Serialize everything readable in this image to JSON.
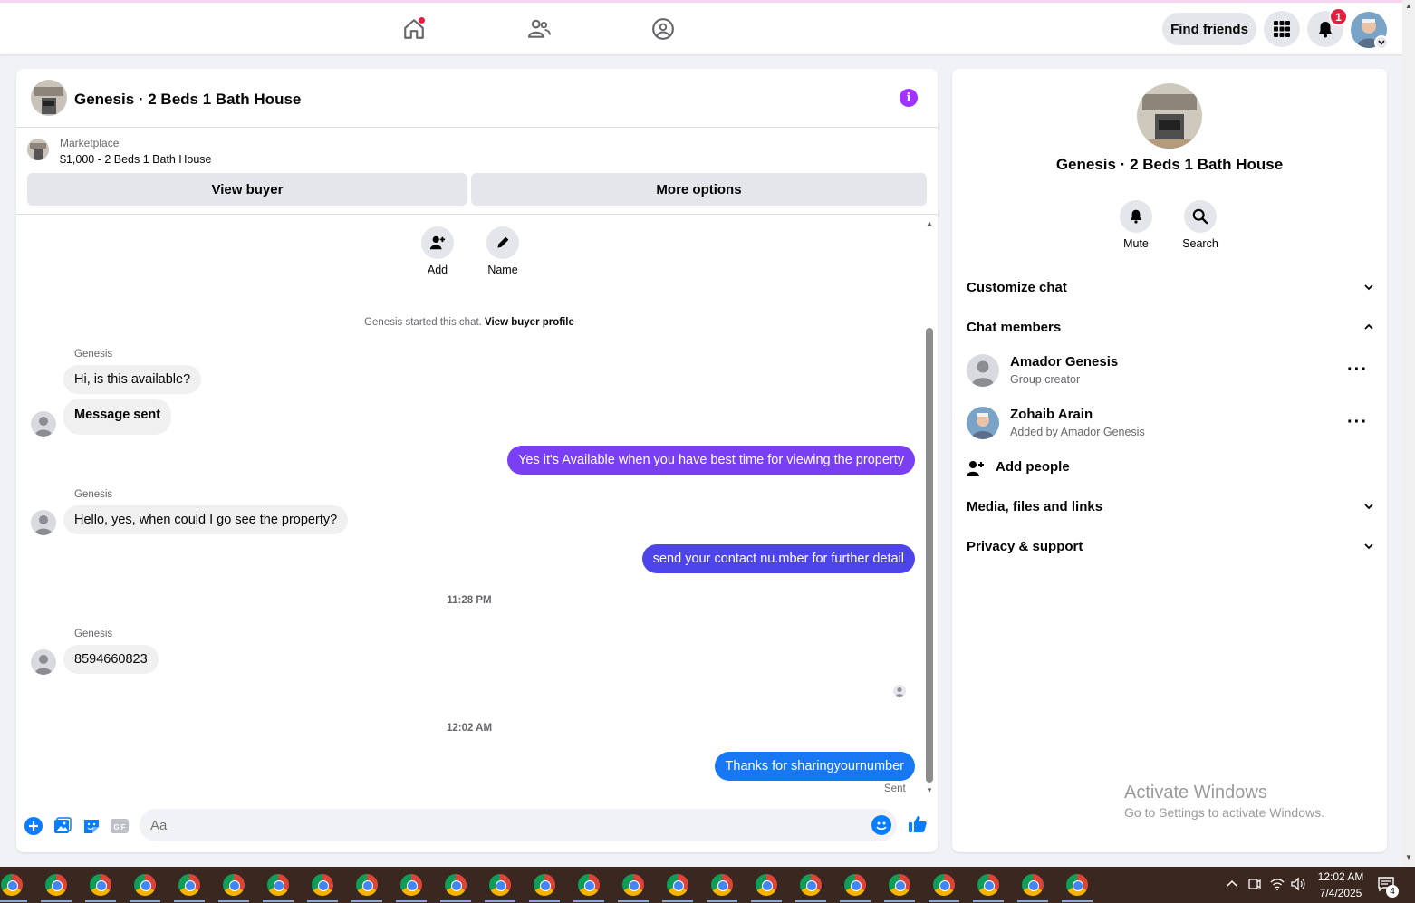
{
  "topnav": {
    "icons": [
      "home-icon",
      "friends-icon",
      "groups-icon"
    ],
    "find_friends_label": "Find friends",
    "notification_count": "1"
  },
  "chat": {
    "title": "Genesis · 2 Beds 1 Bath House",
    "marketplace_label": "Marketplace",
    "listing": "$1,000 - 2 Beds 1 Bath House",
    "view_buyer_label": "View buyer",
    "more_options_label": "More options",
    "actions": [
      {
        "label": "Add",
        "icon": "add-person-icon"
      },
      {
        "label": "Name",
        "icon": "pencil-icon"
      }
    ],
    "started_text": "Genesis started this chat. ",
    "view_profile_label": "View buyer profile",
    "messages": {
      "sender_1": "Genesis",
      "m1": "Hi, is this available?",
      "m2": "Message sent",
      "m3": "Yes it's Available when you have best time for viewing the property",
      "sender_2": "Genesis",
      "m4": "Hello, yes, when could I go see the property?",
      "m5": "send your contact nu.mber for further detail",
      "time_1": "11:28 PM",
      "sender_3": "Genesis",
      "m6": "8594660823",
      "time_2": "12:02 AM",
      "m7": "Thanks for sharingyournumber",
      "status": "Sent"
    },
    "input_placeholder": "Aa",
    "colors": {
      "out_purple": "#7a3ff2",
      "out_indigo": "#4d45ea",
      "out_blue": "#1877f2",
      "accent": "#0a7cff"
    }
  },
  "info": {
    "title": "Genesis · 2 Beds 1 Bath House",
    "mute_label": "Mute",
    "search_label": "Search",
    "customize_label": "Customize chat",
    "members_label": "Chat members",
    "members": [
      {
        "name": "Amador Genesis",
        "sub": "Group creator"
      },
      {
        "name": "Zohaib Arain",
        "sub": "Added by Amador Genesis"
      }
    ],
    "add_people_label": "Add people",
    "media_label": "Media, files and links",
    "privacy_label": "Privacy & support",
    "activate_title": "Activate Windows",
    "activate_sub": "Go to Settings to activate Windows."
  },
  "taskbar": {
    "time": "12:02 AM",
    "date": "7/4/2025",
    "notif_count": "4"
  }
}
